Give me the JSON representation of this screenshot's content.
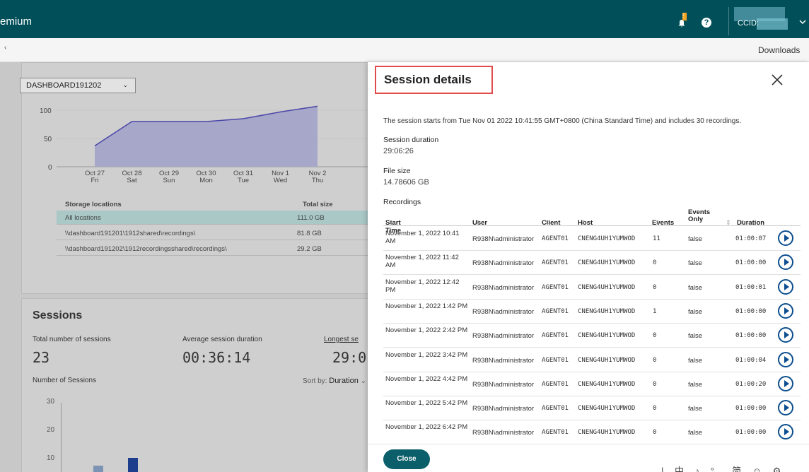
{
  "header": {
    "brand": "emium",
    "notification_badge": "!",
    "help_label": "?",
    "ccid_label": "CCID:",
    "chevron_icon": "chevron-down-icon"
  },
  "subbar": {
    "downloads": "Downloads",
    "left_mark": "‹"
  },
  "dashboard": {
    "site_select": "DASHBOARD191202",
    "storage_chart_data": {
      "type": "area",
      "x": [
        "Oct 27\nFri",
        "Oct 28\nSat",
        "Oct 29\nSun",
        "Oct 30\nMon",
        "Oct 31\nTue",
        "Nov 1\nWed",
        "Nov 2\nThu"
      ],
      "y": [
        37,
        80,
        80,
        80,
        85,
        97,
        107
      ],
      "yticks": [
        "100",
        "50",
        "0"
      ],
      "ylim": [
        0,
        115
      ]
    },
    "xticks": [
      {
        "top": "Oct 27",
        "bottom": "Fri"
      },
      {
        "top": "Oct 28",
        "bottom": "Sat"
      },
      {
        "top": "Oct 29",
        "bottom": "Sun"
      },
      {
        "top": "Oct 30",
        "bottom": "Mon"
      },
      {
        "top": "Oct 31",
        "bottom": "Tue"
      },
      {
        "top": "Nov 1",
        "bottom": "Wed"
      },
      {
        "top": "Nov 2",
        "bottom": "Thu"
      }
    ],
    "storage_table": {
      "headers": [
        "Storage locations",
        "Total size"
      ],
      "rows": [
        {
          "path": "All locations",
          "size": "111.0 GB"
        },
        {
          "path": "\\\\dashboard191201\\1912shared\\recordings\\",
          "size": "81.8 GB"
        },
        {
          "path": "\\\\dashboard191202\\1912recordingsshared\\recordings\\",
          "size": "29.2 GB"
        }
      ]
    },
    "sessions": {
      "title": "Sessions",
      "total_label": "Total number of sessions",
      "total_value": "23",
      "avg_label": "Average session duration",
      "avg_value": "00:36:14",
      "longest_label": "Longest se",
      "longest_value": "29:0",
      "count_label": "Number of Sessions",
      "sort_label": "Sort by:",
      "sort_value": "Duration",
      "yticks": [
        "30",
        "20",
        "10"
      ]
    }
  },
  "panel": {
    "title": "Session details",
    "intro": "The session starts from Tue Nov 01 2022 10:41:55 GMT+0800 (China Standard Time) and includes 30 recordings.",
    "duration_label": "Session duration",
    "duration_value": "29:06:26",
    "filesize_label": "File size",
    "filesize_value": "14.78606 GB",
    "recordings_label": "Recordings",
    "columns": {
      "start": "Start Time",
      "user": "User",
      "client": "Client",
      "host": "Host",
      "events": "Events",
      "events_only": "Events Only",
      "duration": "Duration"
    },
    "rows": [
      {
        "start": "November 1, 2022 10:41 AM",
        "user": "R938N\\administrator",
        "client": "AGENT01",
        "host": "CNENG4UH1YUMWOD",
        "events": "11",
        "events_only": "false",
        "duration": "01:00:07"
      },
      {
        "start": "November 1, 2022 11:42 AM",
        "user": "R938N\\administrator",
        "client": "AGENT01",
        "host": "CNENG4UH1YUMWOD",
        "events": "0",
        "events_only": "false",
        "duration": "01:00:00"
      },
      {
        "start": "November 1, 2022 12:42 PM",
        "user": "R938N\\administrator",
        "client": "AGENT01",
        "host": "CNENG4UH1YUMWOD",
        "events": "0",
        "events_only": "false",
        "duration": "01:00:01"
      },
      {
        "start": "November 1, 2022 1:42 PM",
        "user": "R938N\\administrator",
        "client": "AGENT01",
        "host": "CNENG4UH1YUMWOD",
        "events": "1",
        "events_only": "false",
        "duration": "01:00:00"
      },
      {
        "start": "November 1, 2022 2:42 PM",
        "user": "R938N\\administrator",
        "client": "AGENT01",
        "host": "CNENG4UH1YUMWOD",
        "events": "0",
        "events_only": "false",
        "duration": "01:00:00"
      },
      {
        "start": "November 1, 2022 3:42 PM",
        "user": "R938N\\administrator",
        "client": "AGENT01",
        "host": "CNENG4UH1YUMWOD",
        "events": "0",
        "events_only": "false",
        "duration": "01:00:04"
      },
      {
        "start": "November 1, 2022 4:42 PM",
        "user": "R938N\\administrator",
        "client": "AGENT01",
        "host": "CNENG4UH1YUMWOD",
        "events": "0",
        "events_only": "false",
        "duration": "01:00:20"
      },
      {
        "start": "November 1, 2022 5:42 PM",
        "user": "R938N\\administrator",
        "client": "AGENT01",
        "host": "CNENG4UH1YUMWOD",
        "events": "0",
        "events_only": "false",
        "duration": "01:00:00"
      },
      {
        "start": "November 1, 2022 6:42 PM",
        "user": "R938N\\administrator",
        "client": "AGENT01",
        "host": "CNENG4UH1YUMWOD",
        "events": "0",
        "events_only": "false",
        "duration": "01:00:00"
      }
    ],
    "close_button": "Close",
    "ime_bar": "| 中 ♪ °, 简 ☺ ⚙"
  },
  "colors": {
    "topbar": "#014f59",
    "accent": "#0b5f6b",
    "highlight": "#e24b4b",
    "play": "#0d4e8f"
  }
}
